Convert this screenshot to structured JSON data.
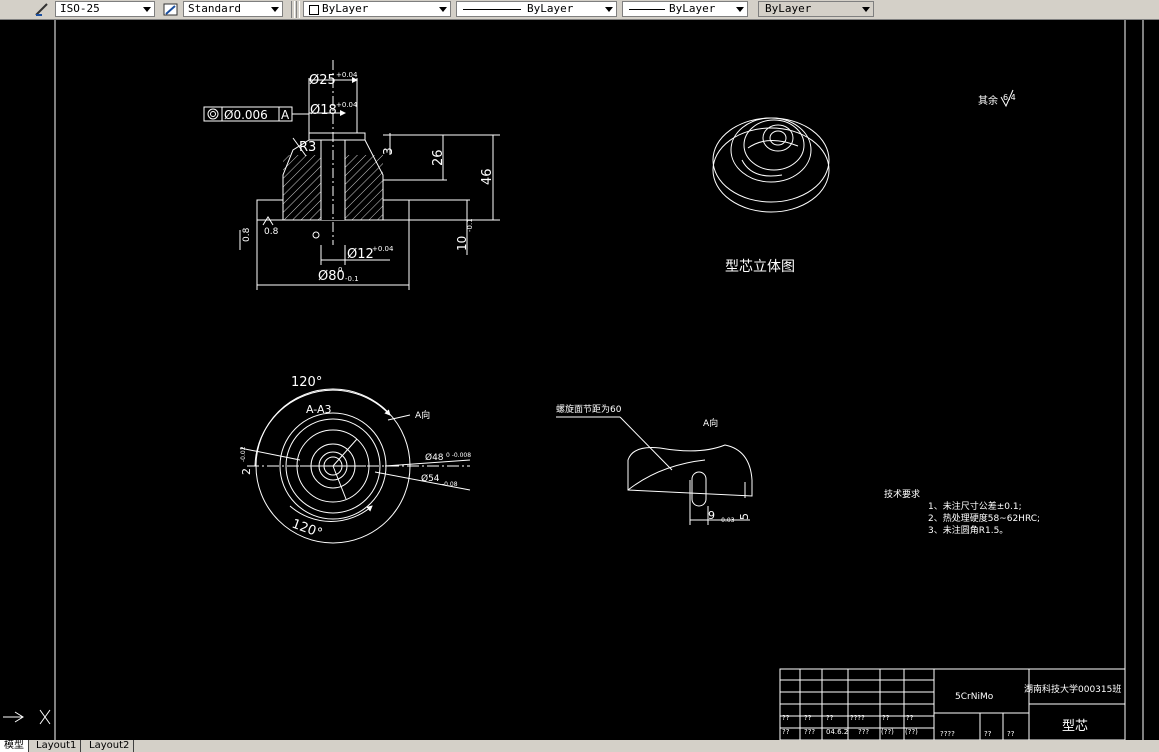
{
  "toolbar": {
    "dim_style": "ISO-25",
    "text_style": "Standard",
    "color": "ByLayer",
    "linetype": "ByLayer",
    "lineweight": "ByLayer",
    "plot_style": "ByLayer"
  },
  "drawing": {
    "iso_view": {
      "d25": "Ø25",
      "d25_tol": "+0.04",
      "d18": "Ø18",
      "d18_tol": "+0.04",
      "geo_tol_value": "Ø0.006",
      "datum_a": "A",
      "radius": "R3",
      "dim_3": "3",
      "dim_26": "26",
      "dim_46": "46",
      "dim_10": "10",
      "dim_10_tol": "-0.1",
      "surface_08_a": "0.8",
      "surface_08_b": "0.8",
      "d12": "Ø12",
      "d12_tol": "+0.04",
      "d80": "Ø80",
      "d80_tol_top": "0",
      "d80_tol_bottom": "-0.1"
    },
    "iso3d_label": "型芯立体图",
    "roughness_note": "其余",
    "roughness_value": "6.4",
    "plan_view": {
      "angle_top": "120°",
      "angle_bottom": "120°",
      "section_label": "A-A3",
      "view_a": "A向",
      "d48": "Ø48",
      "d48_tol": "0\n-0.008",
      "d54": "Ø54",
      "d54_tol": "-0.08",
      "dim_2": "2",
      "dim_2_tol": "-0.02"
    },
    "detail_view": {
      "note": "螺旋面节距为60",
      "view_a": "A向",
      "dim_5": "5",
      "dim_9": "9",
      "dim_9_tol": "-0.03"
    },
    "tech_requirements": {
      "title": "技术要求",
      "items": [
        "1、未注尺寸公差±0.1;",
        "2、热处理硬度58~62HRC;",
        "3、未注圆角R1.5。"
      ]
    },
    "title_block": {
      "material": "5CrNiMo",
      "school": "湖南科技大学000315班",
      "part_name": "型芯",
      "row_a": [
        "??",
        "??",
        "??",
        "????",
        "??",
        "??"
      ],
      "row_b": [
        "??",
        "???",
        "04.6.2",
        "???",
        "(??)",
        "(??)"
      ],
      "small_mark": "????",
      "cell_a": "??",
      "cell_b": "??"
    }
  },
  "tabs": [
    "模型",
    "Layout1",
    "Layout2"
  ]
}
